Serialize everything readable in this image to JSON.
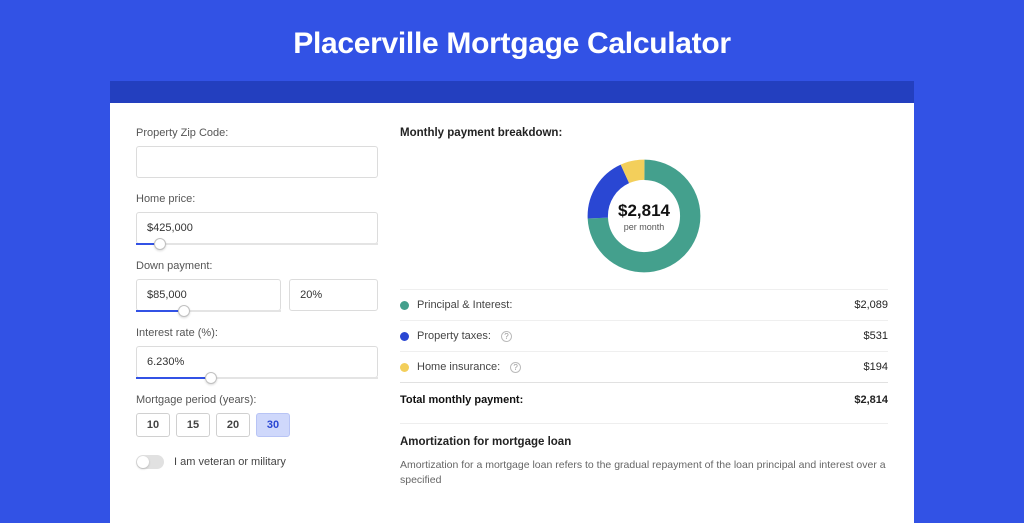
{
  "header": {
    "title": "Placerville Mortgage Calculator"
  },
  "form": {
    "zip": {
      "label": "Property Zip Code:",
      "value": ""
    },
    "price": {
      "label": "Home price:",
      "value": "$425,000",
      "slider_pct": 10
    },
    "down": {
      "label": "Down payment:",
      "value": "$85,000",
      "pct": "20%",
      "slider_pct": 20
    },
    "rate": {
      "label": "Interest rate (%):",
      "value": "6.230%",
      "slider_pct": 31
    },
    "period": {
      "label": "Mortgage period (years):",
      "options": [
        "10",
        "15",
        "20",
        "30"
      ],
      "selected": "30"
    },
    "veteran": {
      "label": "I am veteran or military",
      "on": false
    }
  },
  "breakdown": {
    "title": "Monthly payment breakdown:",
    "center_amount": "$2,814",
    "center_sub": "per month",
    "items": [
      {
        "key": "principal",
        "label": "Principal & Interest:",
        "value": "$2,089",
        "color": "green",
        "info": false
      },
      {
        "key": "taxes",
        "label": "Property taxes:",
        "value": "$531",
        "color": "blue",
        "info": true
      },
      {
        "key": "insurance",
        "label": "Home insurance:",
        "value": "$194",
        "color": "yellow",
        "info": true
      }
    ],
    "total": {
      "label": "Total monthly payment:",
      "value": "$2,814"
    }
  },
  "amort": {
    "title": "Amortization for mortgage loan",
    "text": "Amortization for a mortgage loan refers to the gradual repayment of the loan principal and interest over a specified"
  },
  "chart_data": {
    "type": "pie",
    "title": "Monthly payment breakdown",
    "categories": [
      "Principal & Interest",
      "Property taxes",
      "Home insurance"
    ],
    "values": [
      2089,
      531,
      194
    ],
    "colors": [
      "#44a08d",
      "#2a47d3",
      "#f3cf5b"
    ],
    "total": 2814,
    "center_label": "$2,814 per month"
  }
}
